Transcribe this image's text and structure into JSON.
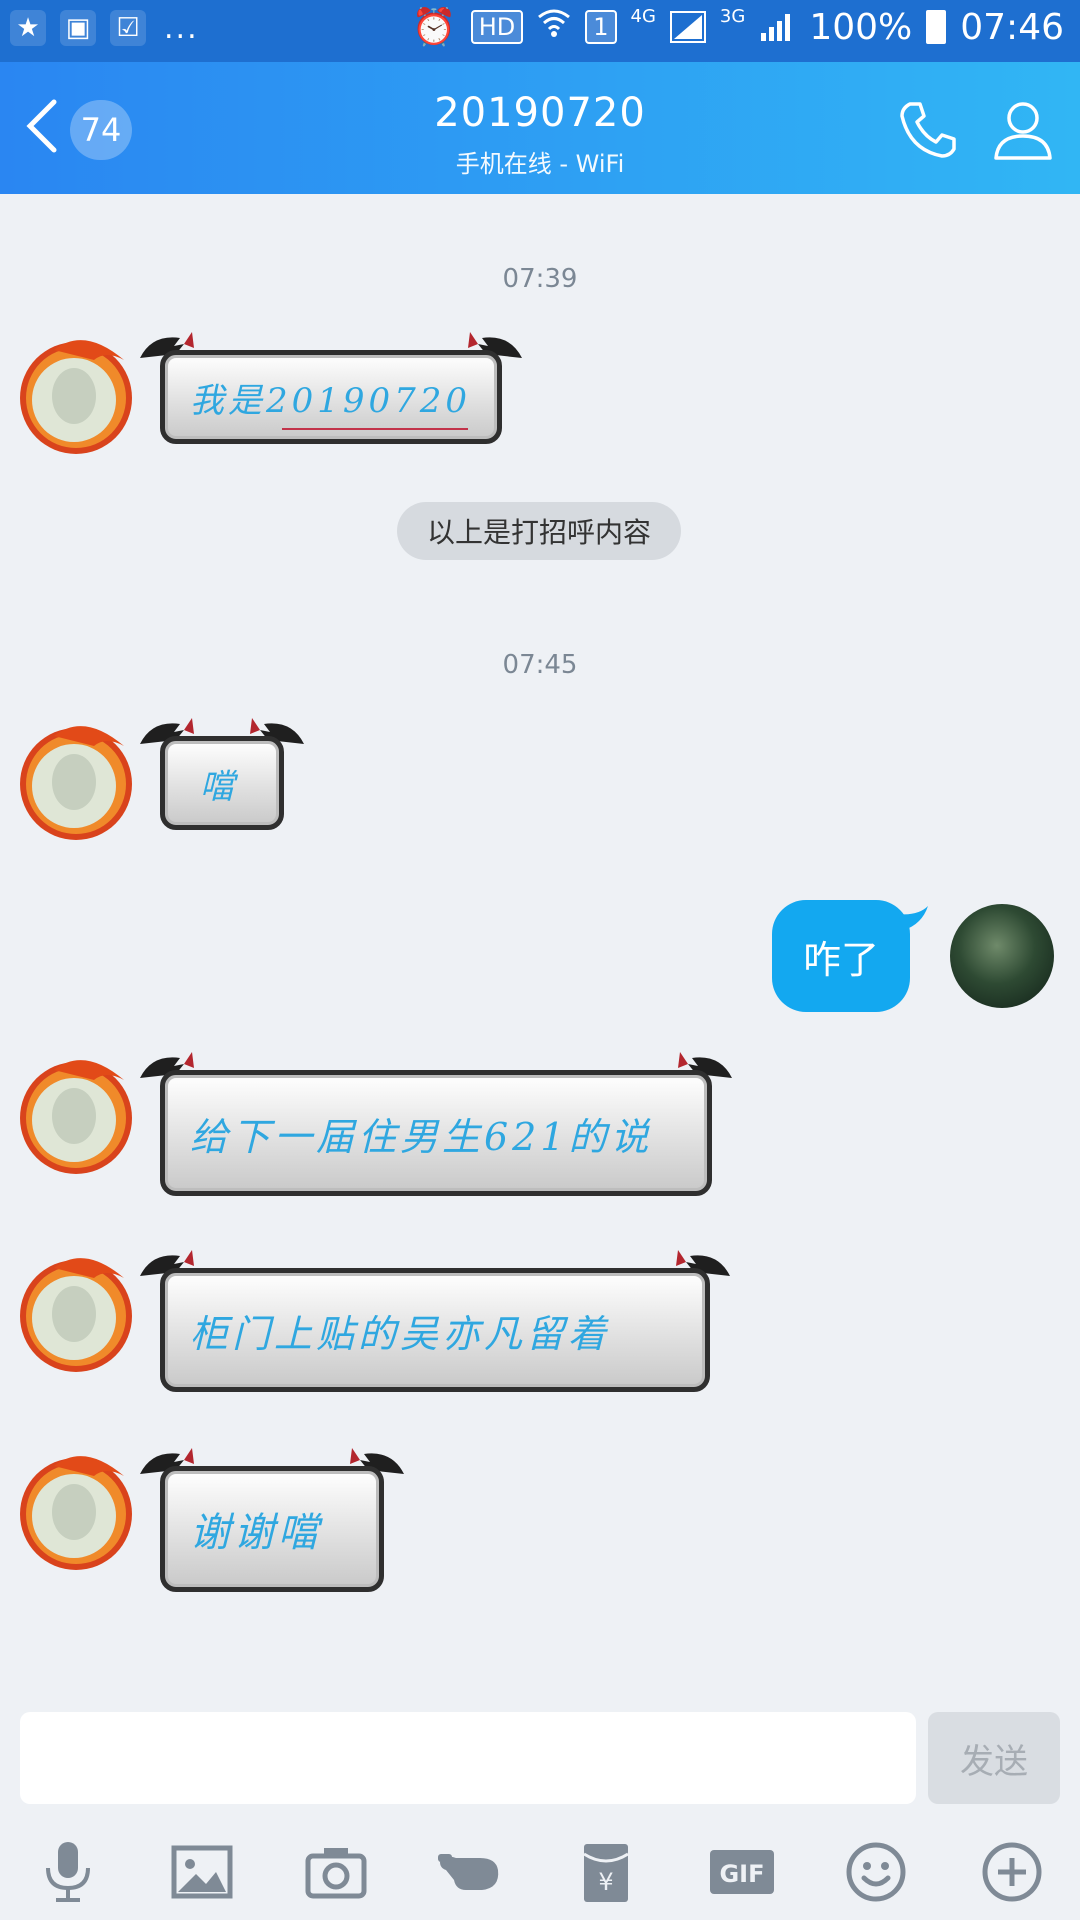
{
  "status_bar": {
    "left_icons": [
      "star-app-icon",
      "gallery-icon",
      "checklist-icon"
    ],
    "more": "...",
    "hd": "HD",
    "sim": "1",
    "network_4g": "4G",
    "network_3g": "3G",
    "battery": "100%",
    "time": "07:46"
  },
  "header": {
    "unread_count": "74",
    "title": "20190720",
    "subtitle": "手机在线 - WiFi"
  },
  "messages": {
    "time1": "07:39",
    "msg1": "我是20190720",
    "system": "以上是打招呼内容",
    "time2": "07:45",
    "msg2": "噹",
    "mine": "咋了",
    "msg3": "给下一届住男生621的说",
    "msg4": "柜门上贴的吴亦凡留着",
    "msg5": "谢谢噹"
  },
  "composer": {
    "input_value": "",
    "send_label": "发送"
  },
  "toolbar": {
    "gif_label": "GIF",
    "items": [
      "mic-icon",
      "image-icon",
      "camera-icon",
      "poke-icon",
      "red-packet-icon",
      "gif-icon",
      "emoji-icon",
      "plus-icon"
    ]
  },
  "colors": {
    "header_start": "#2a86f2",
    "header_end": "#31b6f4",
    "my_bubble": "#13a8f0",
    "background": "#eef1f5"
  }
}
